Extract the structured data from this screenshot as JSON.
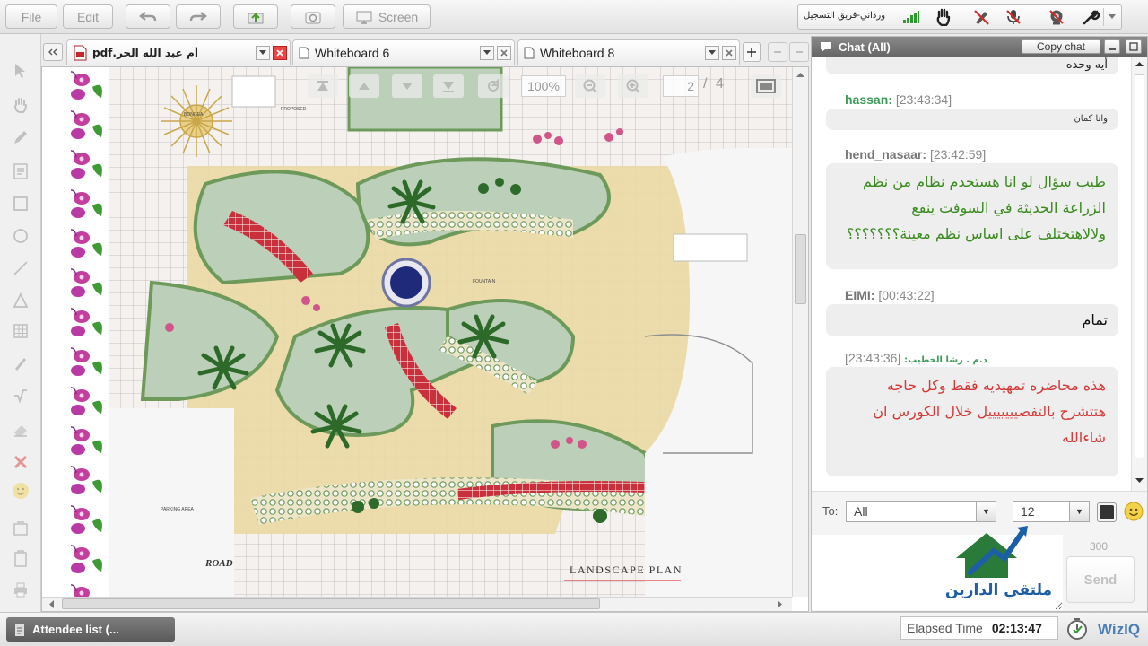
{
  "toolbar": {
    "file_label": "File",
    "edit_label": "Edit",
    "screen_label": "Screen",
    "recording_label": "ورداني-فريق التسجيل",
    "icons": [
      "undo-icon",
      "redo-icon",
      "upload-icon",
      "record-icon",
      "screen-share-icon",
      "signal-bars-icon",
      "raise-hand-icon",
      "pencil-off-icon",
      "mic-off-icon",
      "webcam-icon",
      "settings-wrench-icon"
    ]
  },
  "tabs": [
    {
      "label": "أم عبد الله الحر.pdf",
      "active": true
    },
    {
      "label": "Whiteboard 6",
      "active": false
    },
    {
      "label": "Whiteboard 8",
      "active": false
    }
  ],
  "document": {
    "zoom": "100%",
    "page_current": "2",
    "page_separator": "/",
    "page_total": "4",
    "plan_title": "LANDSCAPE PLAN",
    "road_label": "ROAD",
    "parking_label": "PARKING AREA",
    "fountain_label": "FOUNTAIN",
    "orchid_label": "BONGEA",
    "proposed_label": "PROPOSED"
  },
  "chat": {
    "title": "Chat (All)",
    "copy_label": "Copy chat",
    "partial_message": "أيه وحده",
    "messages": [
      {
        "user": "hassan:",
        "time": "[23:43:34]",
        "text": "وانا كمان",
        "color": "#333333",
        "size": "small"
      },
      {
        "user": "hend_nasaar:",
        "time": "[23:42:59]",
        "text": "طيب سؤال لو انا هستخدم نظام من نظم الزراعة الحديثة في السوفت ينفع ولالاهتختلف على اساس نظم معينة؟؟؟؟؟؟؟",
        "color": "#3a8a1f",
        "size": "large"
      },
      {
        "user": "EIMI:",
        "time": "[00:43:22]",
        "text": "تمام",
        "color": "#111111",
        "size": "large"
      },
      {
        "user": "د.م . رشا الخطيب:",
        "time": "[23:43:36]",
        "text": "هذه محاضره تمهيديه فقط وكل حاجه هتتشرح بالتفصيييييييل خلال الكورس ان شاءالله",
        "color": "#d63838",
        "size": "large"
      }
    ],
    "to_label": "To:",
    "to_value": "All",
    "font_size_value": "12",
    "char_limit": "300",
    "send_label": "Send",
    "text_color": "#333333"
  },
  "bottom": {
    "attendee_label": "Attendee list (...",
    "elapsed_label": "Elapsed Time",
    "elapsed_value": "02:13:47",
    "brand": "WizIQ"
  },
  "watermark": {
    "text": "ملتقي الدارين"
  },
  "colors": {
    "chat_header": "#6f6f6f",
    "send_disabled": "#c2c2c2",
    "tab_close": "#d22b2b"
  }
}
